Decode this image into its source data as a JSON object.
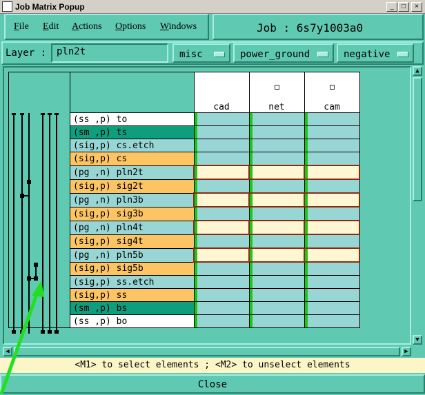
{
  "window": {
    "title": "Job Matrix Popup",
    "min_btn": "_",
    "max_btn": "□",
    "close_btn": "×"
  },
  "menu": [
    {
      "label": "File",
      "key": "F"
    },
    {
      "label": "Edit",
      "key": "E"
    },
    {
      "label": "Actions",
      "key": "A"
    },
    {
      "label": "Options",
      "key": "O"
    },
    {
      "label": "Windows",
      "key": "W"
    }
  ],
  "job": {
    "text": "Job : 6s7y1003a0"
  },
  "layer": {
    "label": "Layer :",
    "value": "pln2t"
  },
  "dropdowns": {
    "misc": "misc",
    "power_ground": "power_ground",
    "polarity": "negative"
  },
  "columns": [
    "cad",
    "net",
    "cam"
  ],
  "rows": [
    {
      "name": "(ss ,p) to",
      "color": "#ffffff",
      "cells": "normal"
    },
    {
      "name": "(sm ,p) ts",
      "color": "#0f9e7d",
      "cells": "normal"
    },
    {
      "name": "(sig,p) cs.etch",
      "color": "#98d6d5",
      "cells": "normal"
    },
    {
      "name": "(sig,p) cs",
      "color": "#fdc463",
      "cells": "normal"
    },
    {
      "name": "(pg ,n) pln2t",
      "color": "#98d6d5",
      "cells": "highlight"
    },
    {
      "name": "(sig,p) sig2t",
      "color": "#fdc463",
      "cells": "normal"
    },
    {
      "name": "(pg ,n) pln3b",
      "color": "#98d6d5",
      "cells": "highlight"
    },
    {
      "name": "(sig,p) sig3b",
      "color": "#fdc463",
      "cells": "normal"
    },
    {
      "name": "(pg ,n) pln4t",
      "color": "#98d6d5",
      "cells": "highlight"
    },
    {
      "name": "(sig,p) sig4t",
      "color": "#fdc463",
      "cells": "normal"
    },
    {
      "name": "(pg ,n) pln5b",
      "color": "#98d6d5",
      "cells": "highlight"
    },
    {
      "name": "(sig,p) sig5b",
      "color": "#fdc463",
      "cells": "normal"
    },
    {
      "name": "(sig,p) ss.etch",
      "color": "#98d6d5",
      "cells": "normal"
    },
    {
      "name": "(sig,p) ss",
      "color": "#fdc463",
      "cells": "normal"
    },
    {
      "name": "(sm ,p) bs",
      "color": "#0f9e7d",
      "cells": "normal"
    },
    {
      "name": "(ss ,p) bo",
      "color": "#ffffff",
      "cells": "normal"
    }
  ],
  "colors": {
    "cell_normal": "#98d6d5",
    "cell_highlight": "#fff7d4",
    "highlight_border": "#8a2b10",
    "active_bar": "#19c819"
  },
  "status": "<M1> to select elements ; <M2> to unselect elements",
  "close_label": "Close"
}
